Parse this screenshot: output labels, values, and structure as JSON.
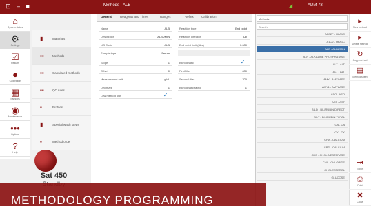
{
  "topbar": {
    "controls": "⊡ ‒ ■",
    "window_title": "Methods - ALB",
    "user": "ADM 78"
  },
  "left_nav": [
    {
      "label": "System status",
      "icon": "⌂"
    },
    {
      "label": "Settings",
      "icon": "⚙"
    },
    {
      "label": "Results",
      "icon": "☑"
    },
    {
      "label": "Calibration",
      "icon": "●"
    },
    {
      "label": "Samples",
      "icon": "▦"
    },
    {
      "label": "Maintenance",
      "icon": "◉"
    },
    {
      "label": "Options",
      "icon": "•••"
    },
    {
      "label": "Help",
      "icon": "?"
    }
  ],
  "sub_nav": [
    {
      "label": "Materials",
      "icon": "▮"
    },
    {
      "label": "Methods",
      "icon": "▪▪"
    },
    {
      "label": "Calculated methods",
      "icon": "▪▪"
    },
    {
      "label": "QC rules",
      "icon": "▪▪"
    },
    {
      "label": "Profiles",
      "icon": "▪"
    },
    {
      "label": "Special wash steps",
      "icon": "▮"
    },
    {
      "label": "Method order",
      "icon": "▪"
    }
  ],
  "instrument": {
    "name": "Sat 450",
    "state": "Standby"
  },
  "tabs": [
    "General",
    "Reagents and Times",
    "Ranges",
    "Reflex",
    "Calibration"
  ],
  "form_left": [
    {
      "label": "Name",
      "value": "ALB"
    },
    {
      "label": "Description",
      "value": "ALBUMIN"
    },
    {
      "label": "LIS Code",
      "value": "ALB"
    },
    {
      "label": "Sample type",
      "value": "Serum"
    },
    {
      "label": "Slope",
      "value": "1"
    },
    {
      "label": "Offset",
      "value": "0"
    },
    {
      "label": "Measurement unit",
      "value": "g/dL"
    },
    {
      "label": "Decimals",
      "value": "1"
    },
    {
      "label": "Low method unit",
      "value": ""
    }
  ],
  "form_right": [
    {
      "label": "Reaction type",
      "value": "End point"
    },
    {
      "label": "Reaction direction",
      "value": "Up"
    },
    {
      "label": "End point limit (Abs)",
      "value": "0.000"
    },
    {
      "label": "Bichromatic",
      "value": ""
    },
    {
      "label": "First filter",
      "value": "630"
    },
    {
      "label": "Second filter",
      "value": "700"
    },
    {
      "label": "Bichromatic factor",
      "value": "1"
    }
  ],
  "methods_list": {
    "header": "Methods",
    "search": "Search",
    "items": [
      "A1C2F - HbA1C",
      "A1C2 - HbA1C",
      "ALB - ALBUMIN",
      "ALP - ALKALINE PHOSPHATASE",
      "ALT - ALT",
      "ALT - ALT",
      "AMY - AMYLASE",
      "AMY1 - AMYLASE",
      "ASO - ASO",
      "AST - AST",
      "BILD - BILIRUBIN DIRECT",
      "BILT - BILIRUBIN TOTAL",
      "CA - CA",
      "CK - CK",
      "CRA - CALCIUM",
      "CRD - CALCIUM",
      "CHE - CHOLINESTERASE",
      "CHL - CHLORIDE",
      "CHOLESTEROL",
      "GLUCOSE"
    ],
    "selected_index": 2
  },
  "right_buttons": [
    {
      "label": "New method",
      "icon": "▸"
    },
    {
      "label": "Delete method",
      "icon": "▸"
    },
    {
      "label": "Copy method",
      "icon": "↻"
    },
    {
      "label": "Method sheet",
      "icon": "▤"
    },
    {
      "label": "Export",
      "icon": "⇥"
    },
    {
      "label": "Print",
      "icon": "⎙"
    },
    {
      "label": "Close",
      "icon": "✖"
    }
  ],
  "banner": "METHODOLOGY PROGRAMMING",
  "colors": {
    "brand": "#8a1414",
    "selection": "#3a6fa8",
    "check": "#2b7bbf"
  }
}
